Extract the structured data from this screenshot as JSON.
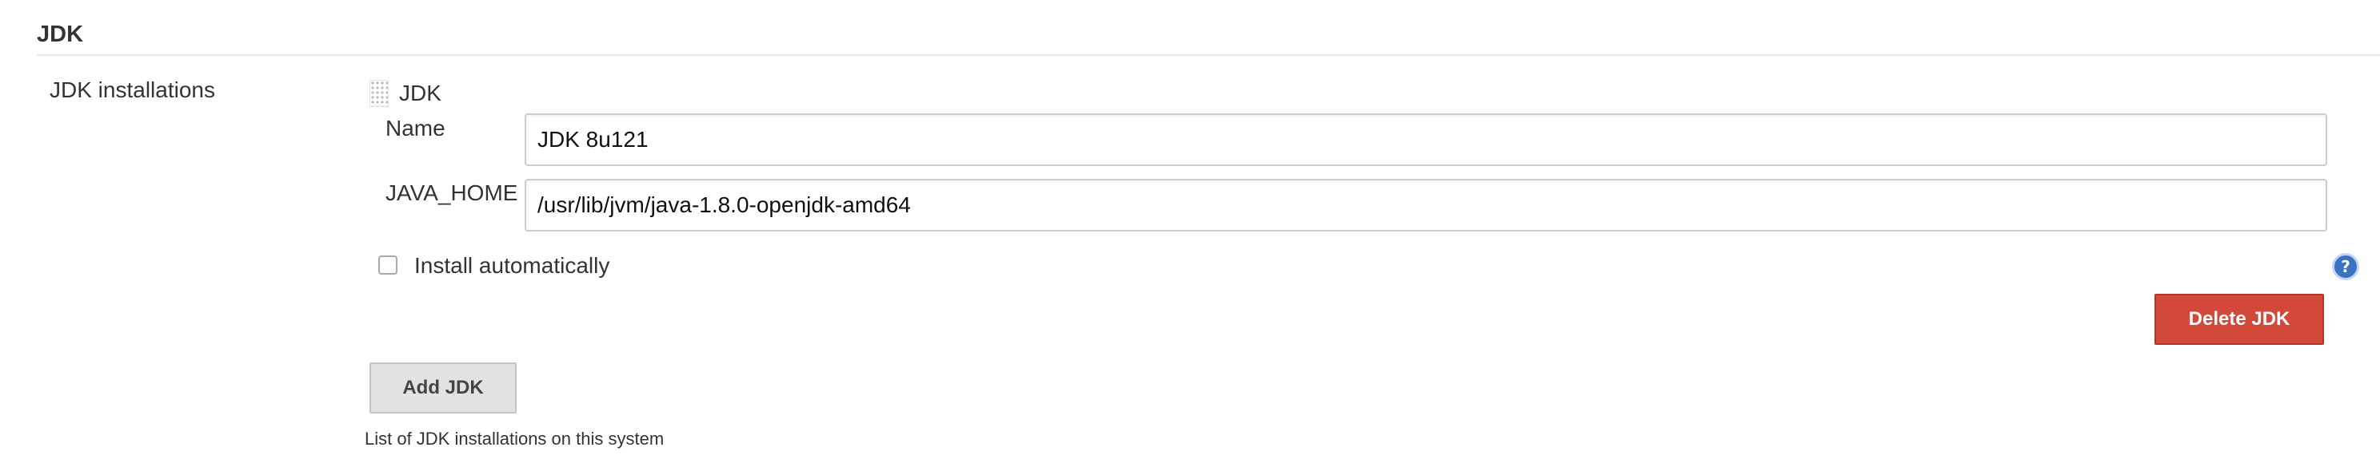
{
  "section": {
    "title": "JDK"
  },
  "jdk_installations": {
    "label": "JDK installations",
    "item": {
      "title": "JDK",
      "name_label": "Name",
      "name_value": "JDK 8u121",
      "java_home_label": "JAVA_HOME",
      "java_home_value": "/usr/lib/jvm/java-1.8.0-openjdk-amd64",
      "install_automatically_label": "Install automatically",
      "install_automatically_checked": false,
      "delete_button_label": "Delete JDK"
    },
    "add_button_label": "Add JDK",
    "description": "List of JDK installations on this system",
    "help_icon_glyph": "?"
  },
  "icons": {
    "drag_handle": "drag-handle-icon",
    "help": "help-icon"
  },
  "colors": {
    "delete_button": "#d24939",
    "add_button": "#e2e2e2",
    "help_icon": "#3a72c4"
  }
}
